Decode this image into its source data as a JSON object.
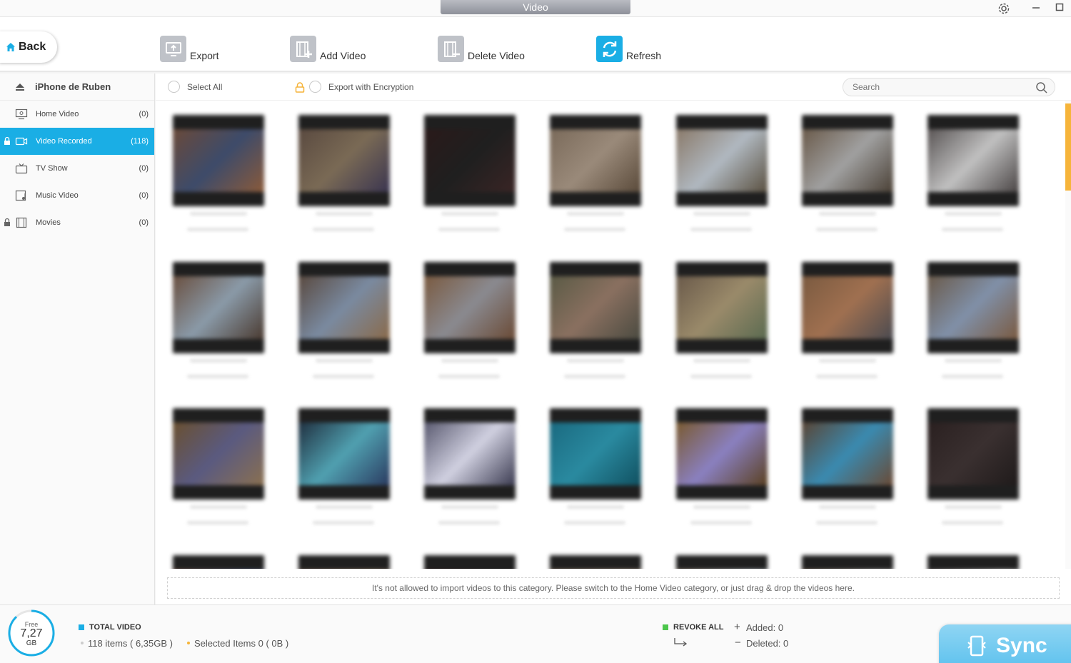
{
  "window": {
    "title": "Video"
  },
  "toolbar": {
    "back_label": "Back",
    "export_label": "Export",
    "add_video_label": "Add Video",
    "delete_video_label": "Delete Video",
    "refresh_label": "Refresh"
  },
  "sidebar": {
    "device_name": "iPhone de Ruben",
    "items": [
      {
        "label": "Home Video",
        "count": "(0)",
        "icon": "monitor-icon",
        "locked": false
      },
      {
        "label": "Video Recorded",
        "count": "(118)",
        "icon": "camera-icon",
        "locked": true,
        "active": true
      },
      {
        "label": "TV Show",
        "count": "(0)",
        "icon": "tv-icon",
        "locked": false
      },
      {
        "label": "Music Video",
        "count": "(0)",
        "icon": "music-video-icon",
        "locked": false
      },
      {
        "label": "Movies",
        "count": "(0)",
        "icon": "film-icon",
        "locked": true
      }
    ]
  },
  "subbar": {
    "select_all_label": "Select All",
    "export_encryption_label": "Export with Encryption",
    "search_placeholder": "Search"
  },
  "notice": "It's not allowed to import videos to this category.  Please switch to the Home Video category, or just drag & drop the videos here.",
  "status": {
    "free_label": "Free",
    "free_value": "7,27",
    "free_unit": "GB",
    "free_fraction": 0.88,
    "total_title": "TOTAL VIDEO",
    "total_items": "118 items ( 6,35GB )",
    "selected_items": "Selected Items 0 ( 0B )",
    "revoke_label": "REVOKE ALL",
    "added_label": "Added: 0",
    "deleted_label": "Deleted: 0",
    "sync_label": "Sync"
  },
  "colors": {
    "accent": "#1aaee5",
    "scrollbar": "#f6b43a",
    "revoke": "#4cc64c"
  }
}
